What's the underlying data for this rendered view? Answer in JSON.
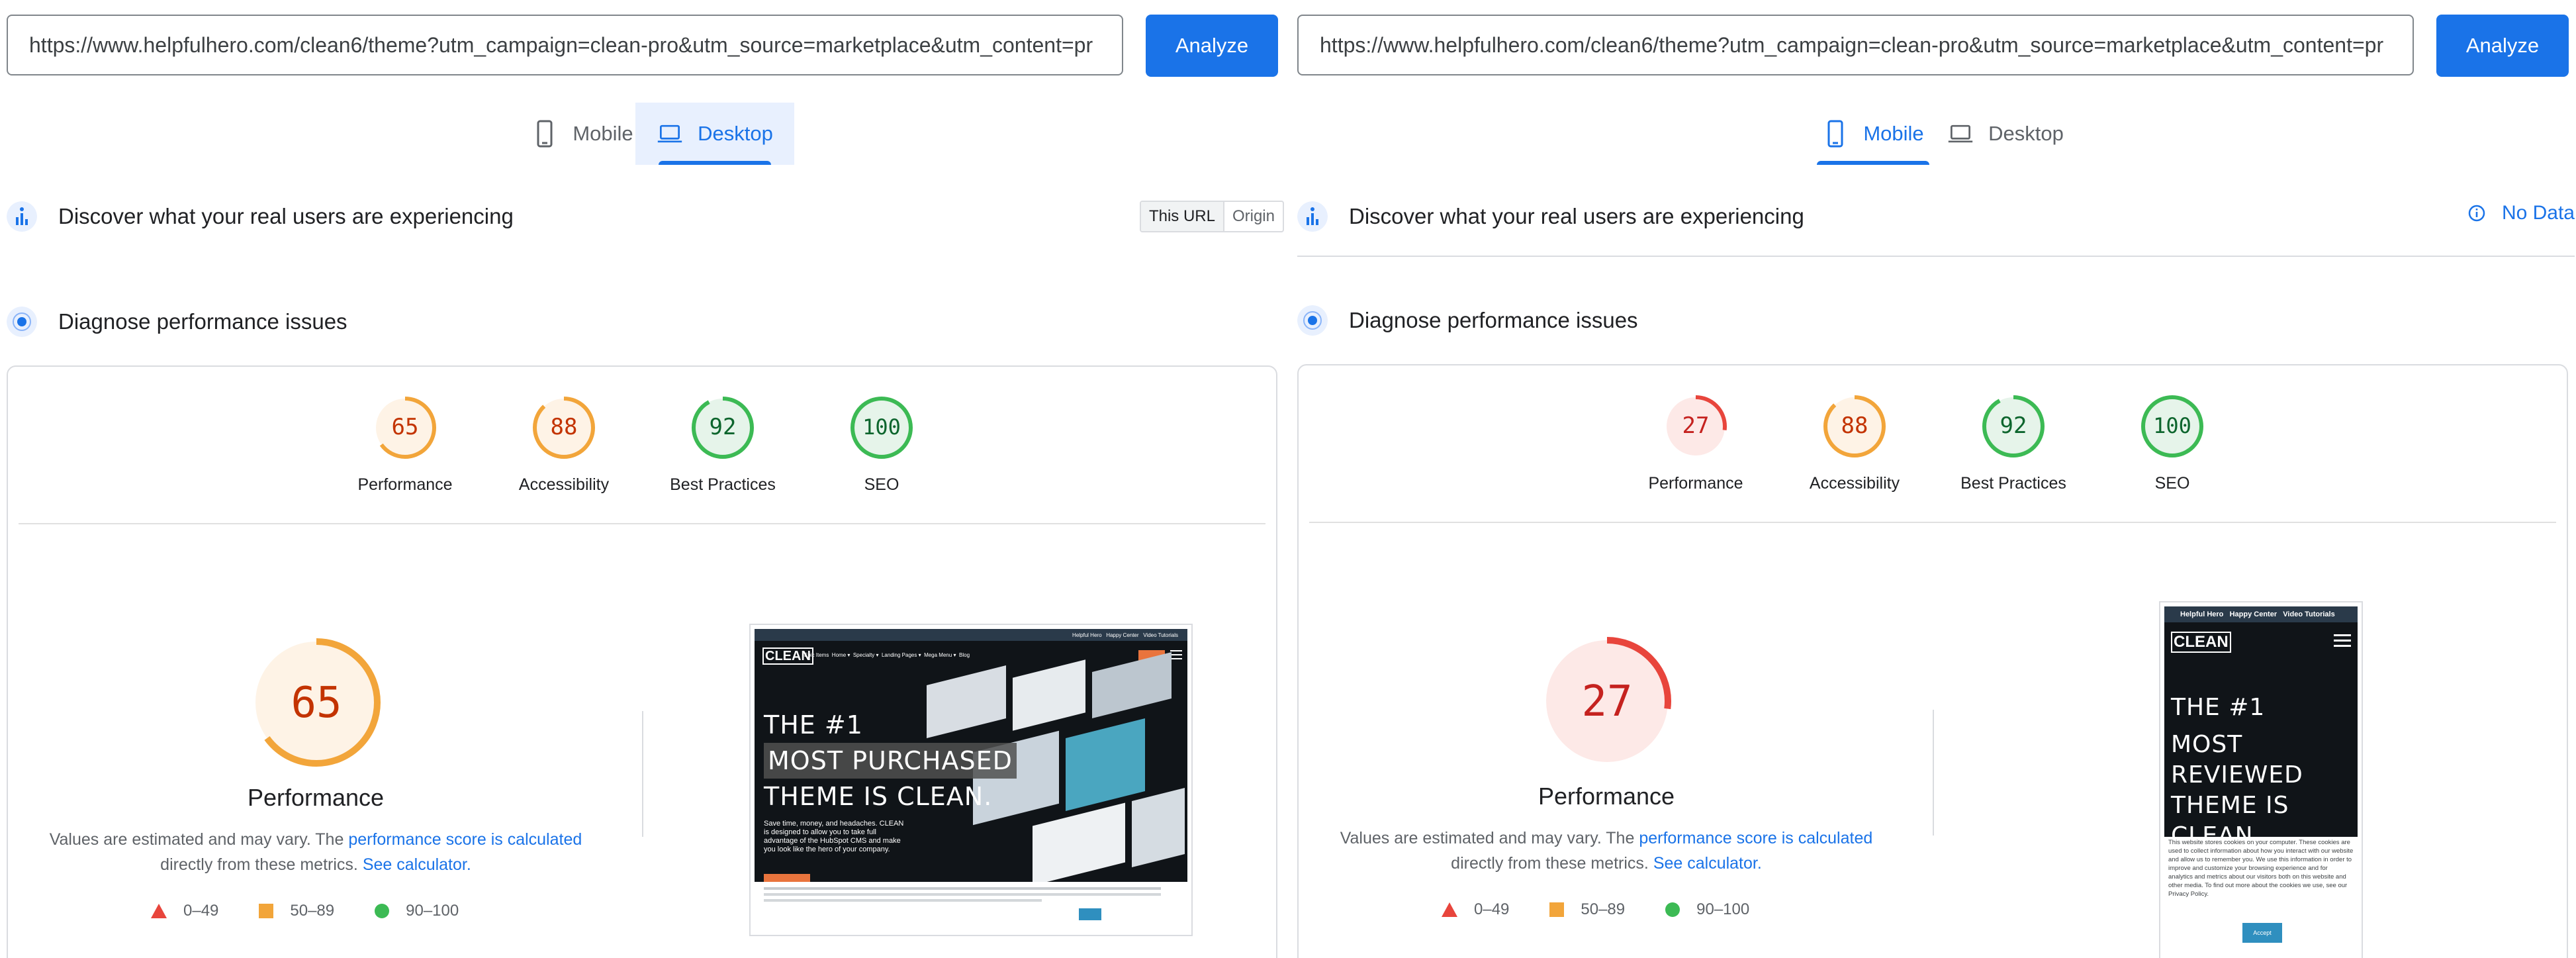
{
  "left": {
    "url": "https://www.helpfulhero.com/clean6/theme?utm_campaign=clean-pro&utm_source=marketplace&utm_content=pr",
    "analyze_label": "Analyze",
    "tabs": [
      {
        "label": "Mobile",
        "icon": "phone-icon"
      },
      {
        "label": "Desktop",
        "icon": "laptop-icon"
      }
    ],
    "active_tab": "Desktop",
    "real_users_title": "Discover what your real users are experiencing",
    "toggle": [
      "This URL",
      "Origin"
    ],
    "diagnose_title": "Diagnose performance issues",
    "scores": [
      {
        "label": "Performance",
        "value": "65"
      },
      {
        "label": "Accessibility",
        "value": "88"
      },
      {
        "label": "Best Practices",
        "value": "92"
      },
      {
        "label": "SEO",
        "value": "100"
      }
    ],
    "perf": {
      "value": "65",
      "title": "Performance",
      "desc_prefix": "Values are estimated and may vary. The ",
      "desc_link": "performance score is calculated",
      "desc_mid": "directly from these metrics. ",
      "desc_link2": "See calculator."
    },
    "legend": [
      "0–49",
      "50–89",
      "90–100"
    ],
    "screenshot": {
      "nav": [
        "Helpful Hero",
        "Happy Center",
        "Video Tutorials"
      ],
      "logo": "CLEAN",
      "menu": [
        "Epic Items",
        "Home ▾",
        "Specialty ▾",
        "Landing Pages ▾",
        "Mega Menu ▾",
        "Blog"
      ],
      "hero_lines": [
        "THE #1",
        "MOST PURCHASED",
        "THEME IS CLEAN."
      ],
      "subtext": "Save time, money, and headaches. CLEAN is designed to allow you to take full advantage of the HubSpot CMS and make you look like the hero of your company."
    }
  },
  "right": {
    "url": "https://www.helpfulhero.com/clean6/theme?utm_campaign=clean-pro&utm_source=marketplace&utm_content=pr",
    "analyze_label": "Analyze",
    "tabs": [
      {
        "label": "Mobile",
        "icon": "phone-icon"
      },
      {
        "label": "Desktop",
        "icon": "laptop-icon"
      }
    ],
    "active_tab": "Mobile",
    "real_users_title": "Discover what your real users are experiencing",
    "no_data": "No Data",
    "diagnose_title": "Diagnose performance issues",
    "scores": [
      {
        "label": "Performance",
        "value": "27"
      },
      {
        "label": "Accessibility",
        "value": "88"
      },
      {
        "label": "Best Practices",
        "value": "92"
      },
      {
        "label": "SEO",
        "value": "100"
      }
    ],
    "perf": {
      "value": "27",
      "title": "Performance",
      "desc_prefix": "Values are estimated and may vary. The ",
      "desc_link": "performance score is calculated",
      "desc_mid": "directly from these metrics. ",
      "desc_link2": "See calculator."
    },
    "legend": [
      "0–49",
      "50–89",
      "90–100"
    ],
    "screenshot": {
      "nav": [
        "Helpful Hero",
        "Happy Center",
        "Video Tutorials"
      ],
      "logo": "CLEAN",
      "hero_lines": [
        "THE #1",
        "MOST",
        "REVIEWED",
        "THEME IS CLEAN."
      ],
      "cookie_text": "This website stores cookies on your computer. These cookies are used to collect information about how you interact with our website and allow us to remember you. We use this information in order to improve and customize your browsing experience and for analytics and metrics about our visitors both on this website and other media. To find out more about the cookies we use, see our Privacy Policy.",
      "accept": "Accept"
    }
  },
  "colors": {
    "fail": "#e8453c",
    "fail_bg": "#fde9e7",
    "average": "#f2a53a",
    "average_bg": "#fef3e6",
    "pass": "#3cba54",
    "pass_bg": "#e6f4ea",
    "accent": "#1a73e8"
  }
}
